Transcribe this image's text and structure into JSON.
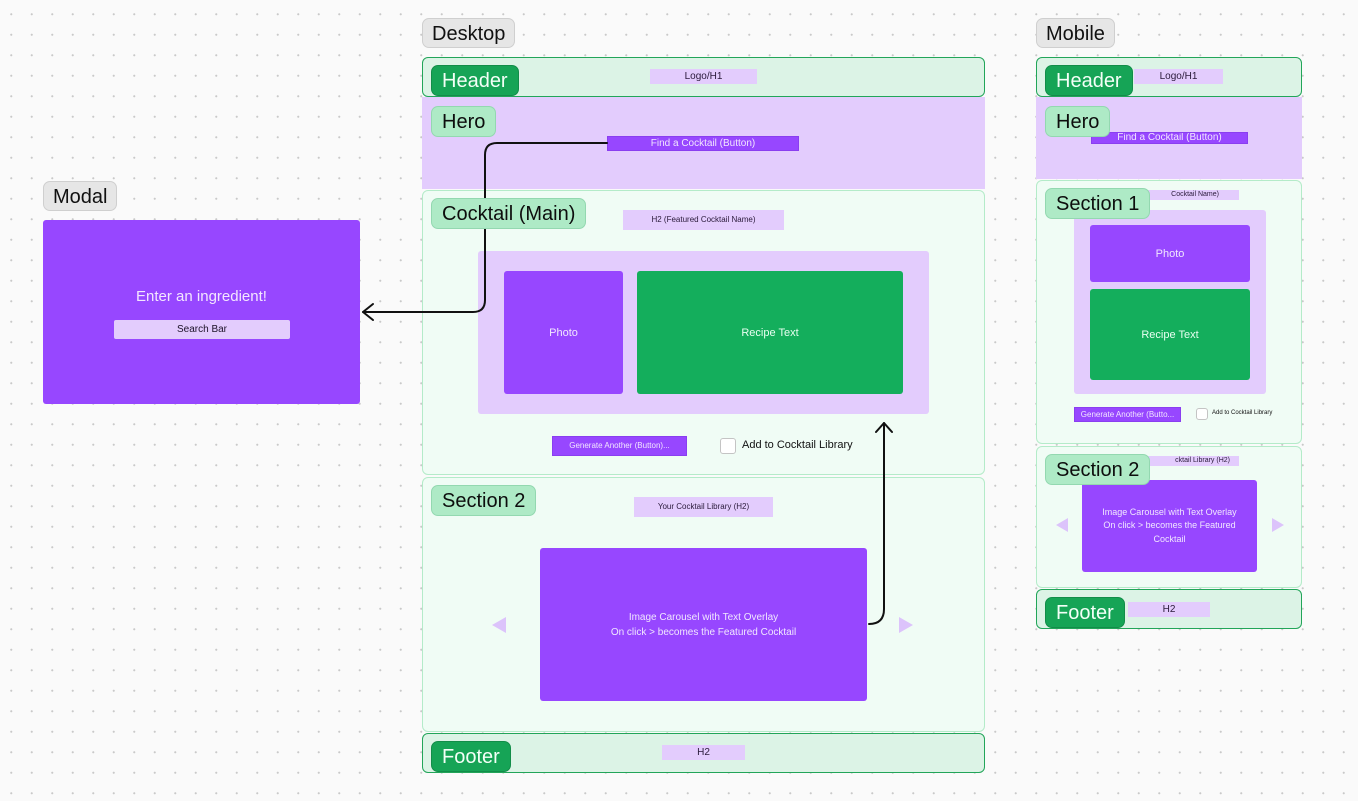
{
  "colors": {
    "brand_purple": "#9747ff",
    "light_purple": "#e3ccfd",
    "brand_green": "#14ae5c",
    "light_green": "#f0fcf5",
    "header_green": "#dcf3e6",
    "tag_green": "#aeeac6"
  },
  "modal": {
    "frame_title": "Modal",
    "heading": "Enter an ingredient!",
    "search_bar": "Search Bar"
  },
  "desktop": {
    "frame_title": "Desktop",
    "header": {
      "tag": "Header",
      "logo": "Logo/H1"
    },
    "hero": {
      "tag": "Hero",
      "cta_button": "Find a Cocktail (Button)"
    },
    "main": {
      "tag": "Cocktail (Main)",
      "h2": "H2 (Featured Cocktail Name)",
      "photo": "Photo",
      "recipe": "Recipe Text",
      "generate_button": "Generate Another (Button)...",
      "checkbox_label": "Add to Cocktail Library",
      "checkbox_checked": false
    },
    "section2": {
      "tag": "Section 2",
      "h2": "Your Cocktail Library (H2)",
      "carousel_line1": "Image Carousel with Text Overlay",
      "carousel_line2": "On click > becomes the Featured Cocktail"
    },
    "footer": {
      "tag": "Footer",
      "h2": "H2"
    }
  },
  "mobile": {
    "frame_title": "Mobile",
    "header": {
      "tag": "Header",
      "logo": "Logo/H1"
    },
    "hero": {
      "tag": "Hero",
      "cta_button": "Find a Cocktail (Button)"
    },
    "section1": {
      "tag": "Section 1",
      "h2_visible": "Cocktail Name)",
      "photo": "Photo",
      "recipe": "Recipe Text",
      "generate_button": "Generate Another (Butto...",
      "checkbox_label": "Add to Cocktail Library",
      "checkbox_checked": false
    },
    "section2": {
      "tag": "Section 2",
      "h2_visible": "cktail Library (H2)",
      "carousel_line1": "Image Carousel with Text Overlay",
      "carousel_line2": "On click > becomes the Featured",
      "carousel_line3": "Cocktail"
    },
    "footer": {
      "tag": "Footer",
      "h2": "H2"
    }
  }
}
